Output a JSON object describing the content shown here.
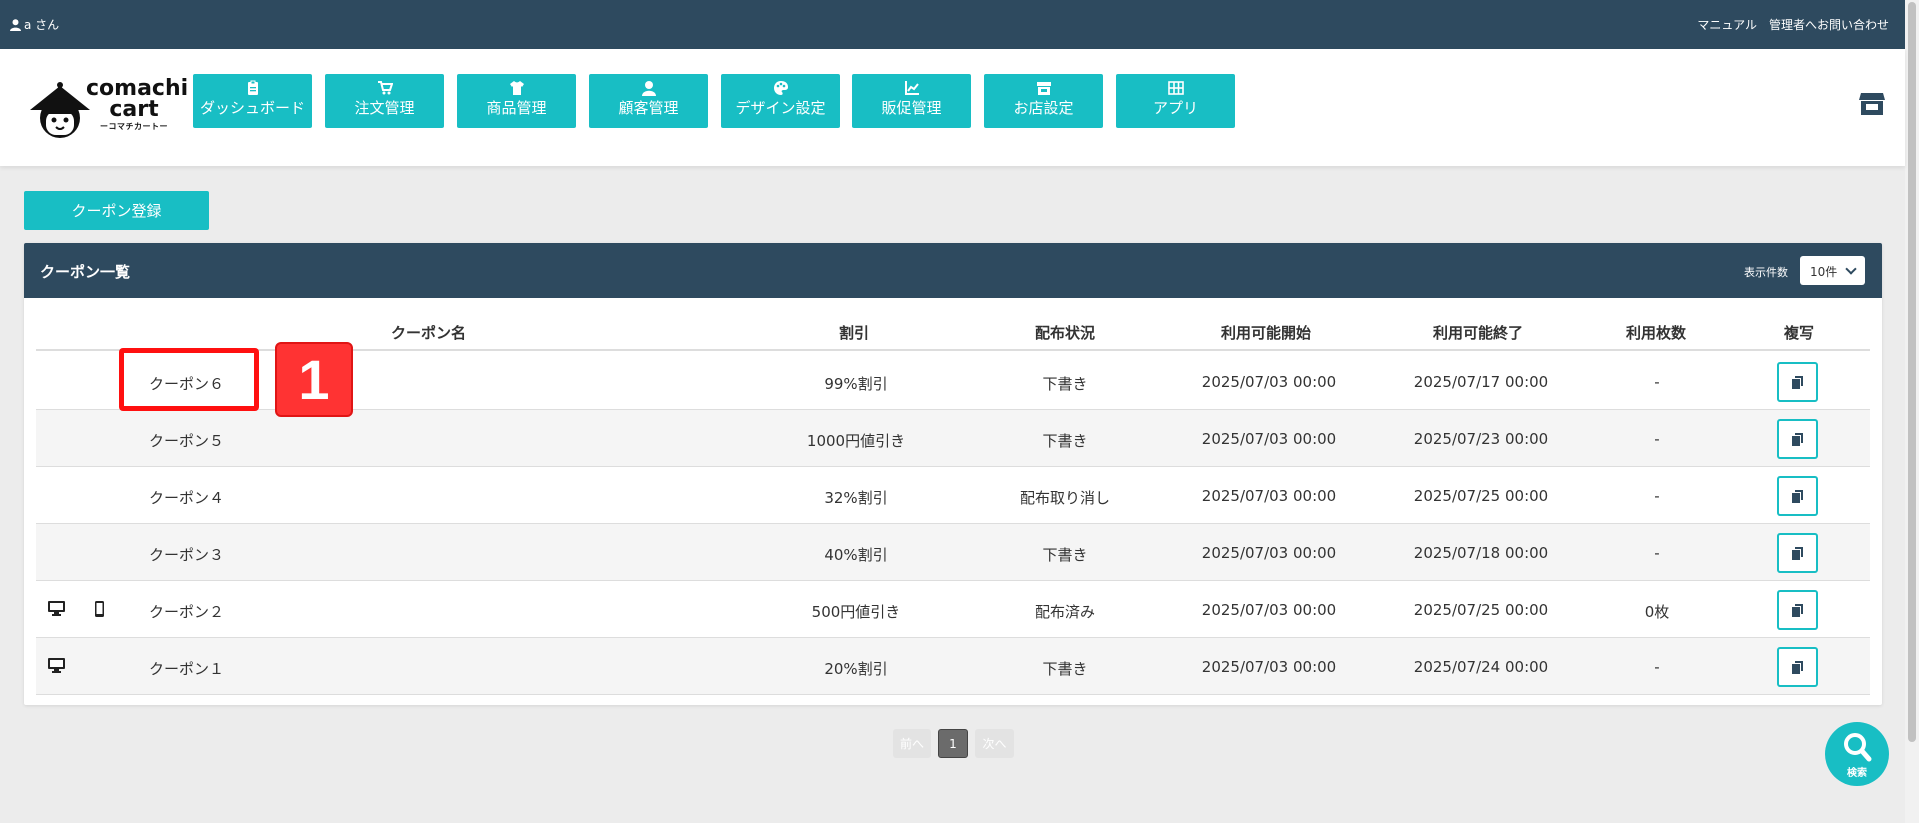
{
  "topbar": {
    "user": "a さん",
    "manual": "マニュアル",
    "contact": "管理者へお問い合わせ"
  },
  "logo": {
    "line1": "comachi",
    "line2": "cart",
    "line3": "ーコマチカートー"
  },
  "nav": [
    {
      "label": "ダッシュボード",
      "icon": "clipboard-icon"
    },
    {
      "label": "注文管理",
      "icon": "cart-icon"
    },
    {
      "label": "商品管理",
      "icon": "shirt-icon"
    },
    {
      "label": "顧客管理",
      "icon": "user-icon"
    },
    {
      "label": "デザイン設定",
      "icon": "palette-icon"
    },
    {
      "label": "販促管理",
      "icon": "chart-icon"
    },
    {
      "label": "お店設定",
      "icon": "store-icon"
    },
    {
      "label": "アプリ",
      "icon": "grid-icon"
    }
  ],
  "register_button": "クーポン登録",
  "panel": {
    "title": "クーポン一覧",
    "count_label": "表示件数",
    "count_value": "10件"
  },
  "columns": {
    "name": "クーポン名",
    "discount": "割引",
    "status": "配布状況",
    "start": "利用可能開始",
    "end": "利用可能終了",
    "used": "利用枚数",
    "copy": "複写"
  },
  "rows": [
    {
      "name": "クーポン６",
      "discount": "99%割引",
      "status": "下書き",
      "start": "2025/07/03 00:00",
      "end": "2025/07/17 00:00",
      "used": "-",
      "pc": false,
      "mobile": false
    },
    {
      "name": "クーポン５",
      "discount": "1000円値引き",
      "status": "下書き",
      "start": "2025/07/03 00:00",
      "end": "2025/07/23 00:00",
      "used": "-",
      "pc": false,
      "mobile": false
    },
    {
      "name": "クーポン４",
      "discount": "32%割引",
      "status": "配布取り消し",
      "start": "2025/07/03 00:00",
      "end": "2025/07/25 00:00",
      "used": "-",
      "pc": false,
      "mobile": false
    },
    {
      "name": "クーポン３",
      "discount": "40%割引",
      "status": "下書き",
      "start": "2025/07/03 00:00",
      "end": "2025/07/18 00:00",
      "used": "-",
      "pc": false,
      "mobile": false
    },
    {
      "name": "クーポン２",
      "discount": "500円値引き",
      "status": "配布済み",
      "start": "2025/07/03 00:00",
      "end": "2025/07/25 00:00",
      "used": "0枚",
      "pc": true,
      "mobile": true
    },
    {
      "name": "クーポン１",
      "discount": "20%割引",
      "status": "下書き",
      "start": "2025/07/03 00:00",
      "end": "2025/07/24 00:00",
      "used": "-",
      "pc": true,
      "mobile": false
    }
  ],
  "annotation": {
    "badge": "1"
  },
  "pagination": {
    "prev": "前へ",
    "page": "1",
    "next": "次へ"
  },
  "search_fab": "検索",
  "colors": {
    "accent": "#18bec4",
    "header": "#2e4a5f",
    "highlight": "#ff1010"
  }
}
